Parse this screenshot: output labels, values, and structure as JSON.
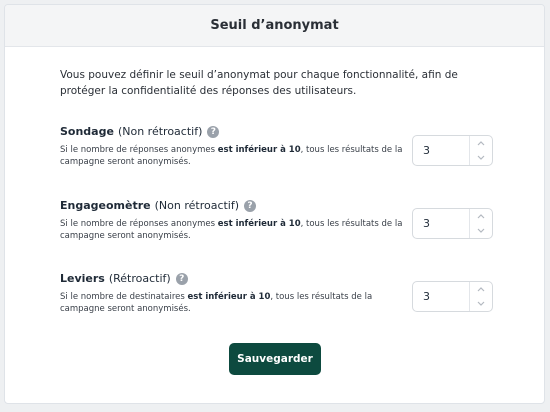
{
  "header": {
    "title": "Seuil d’anonymat"
  },
  "intro": "Vous pouvez définir le seuil d’anonymat pour chaque fonctionnalité, afin de protéger la confidentialité des réponses des utilisateurs.",
  "settings": [
    {
      "name": "Sondage",
      "mode": "(Non rétroactif)",
      "desc_before": "Si le nombre de réponses anonymes ",
      "desc_bold": "est inférieur à 10",
      "desc_after": ", tous les résultats de la campagne seront anonymisés.",
      "value": "3"
    },
    {
      "name": "Engageomètre",
      "mode": "(Non rétroactif)",
      "desc_before": "Si le nombre de réponses anonymes ",
      "desc_bold": "est inférieur à 10",
      "desc_after": ", tous les résultats de la campagne seront anonymisés.",
      "value": "3"
    },
    {
      "name": "Leviers",
      "mode": "(Rétroactif)",
      "desc_before": "Si le nombre de destinataires ",
      "desc_bold": "est inférieur à 10",
      "desc_after": ", tous les résultats de la campagne seront anonymisés.",
      "value": "3"
    }
  ],
  "help_glyph": "?",
  "save_label": "Sauvegarder",
  "colors": {
    "primary_button": "#0d4a3f",
    "header_bg": "#f4f5f6"
  },
  "icons": {
    "help": "question-circle-icon",
    "increment": "chevron-up-icon",
    "decrement": "chevron-down-icon"
  }
}
